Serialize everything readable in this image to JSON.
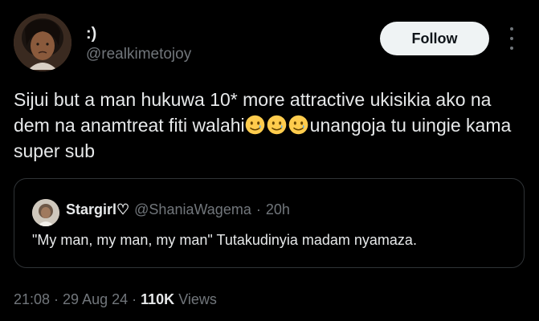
{
  "author": {
    "display_name": ":)",
    "handle": "@realkimetojoy"
  },
  "follow_button": {
    "label": "Follow"
  },
  "tweet": {
    "text_before_emoji": "Sijui but a man hukuwa 10* more attractive ukisikia ako na dem na anamtreat fiti walahi",
    "emoji_name": "smiling-face-with-tear",
    "emoji_count": 3,
    "text_after_emoji": "unangoja tu uingie kama super sub"
  },
  "quoted_tweet": {
    "display_name": "Stargirl♡",
    "handle": "@ShaniaWagema",
    "separator": "·",
    "time": "20h",
    "text": "\"My man, my man, my man\" Tutakudinyia madam nyamaza."
  },
  "meta": {
    "time": "21:08",
    "sep1": "·",
    "date": "29 Aug 24",
    "sep2": "·",
    "views_count": "110K",
    "views_label": "Views"
  },
  "colors": {
    "background": "#000000",
    "text_primary": "#e7e9ea",
    "text_secondary": "#71767b",
    "border": "#2f3336",
    "button_bg": "#eff3f4",
    "emoji_yellow": "#ffcc4d"
  }
}
